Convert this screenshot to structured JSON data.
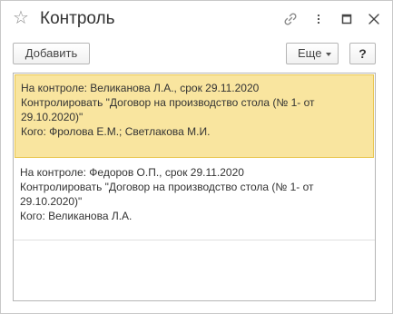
{
  "window": {
    "title": "Контроль",
    "icons": [
      "star-icon",
      "link-icon",
      "more-vert-icon",
      "maximize-icon",
      "close-icon"
    ]
  },
  "toolbar": {
    "add_label": "Добавить",
    "more_label": "Еще",
    "help_label": "?"
  },
  "items": [
    {
      "selected": true,
      "lines": [
        "На контроле: Великанова Л.А., срок 29.11.2020",
        "Контролировать \"Договор на производство стола (№ 1- от",
        "29.10.2020)\"",
        "Кого: Фролова Е.М.; Светлакова М.И."
      ]
    },
    {
      "selected": false,
      "lines": [
        "На контроле: Федоров О.П., срок 29.11.2020",
        "Контролировать \"Договор на производство стола (№ 1- от",
        "29.10.2020)\"",
        "Кого: Великанова Л.А."
      ]
    }
  ],
  "colors": {
    "selected_bg": "#f9e59f",
    "selected_border": "#e9c64f",
    "text": "#333333",
    "border": "#b5b5b5"
  }
}
